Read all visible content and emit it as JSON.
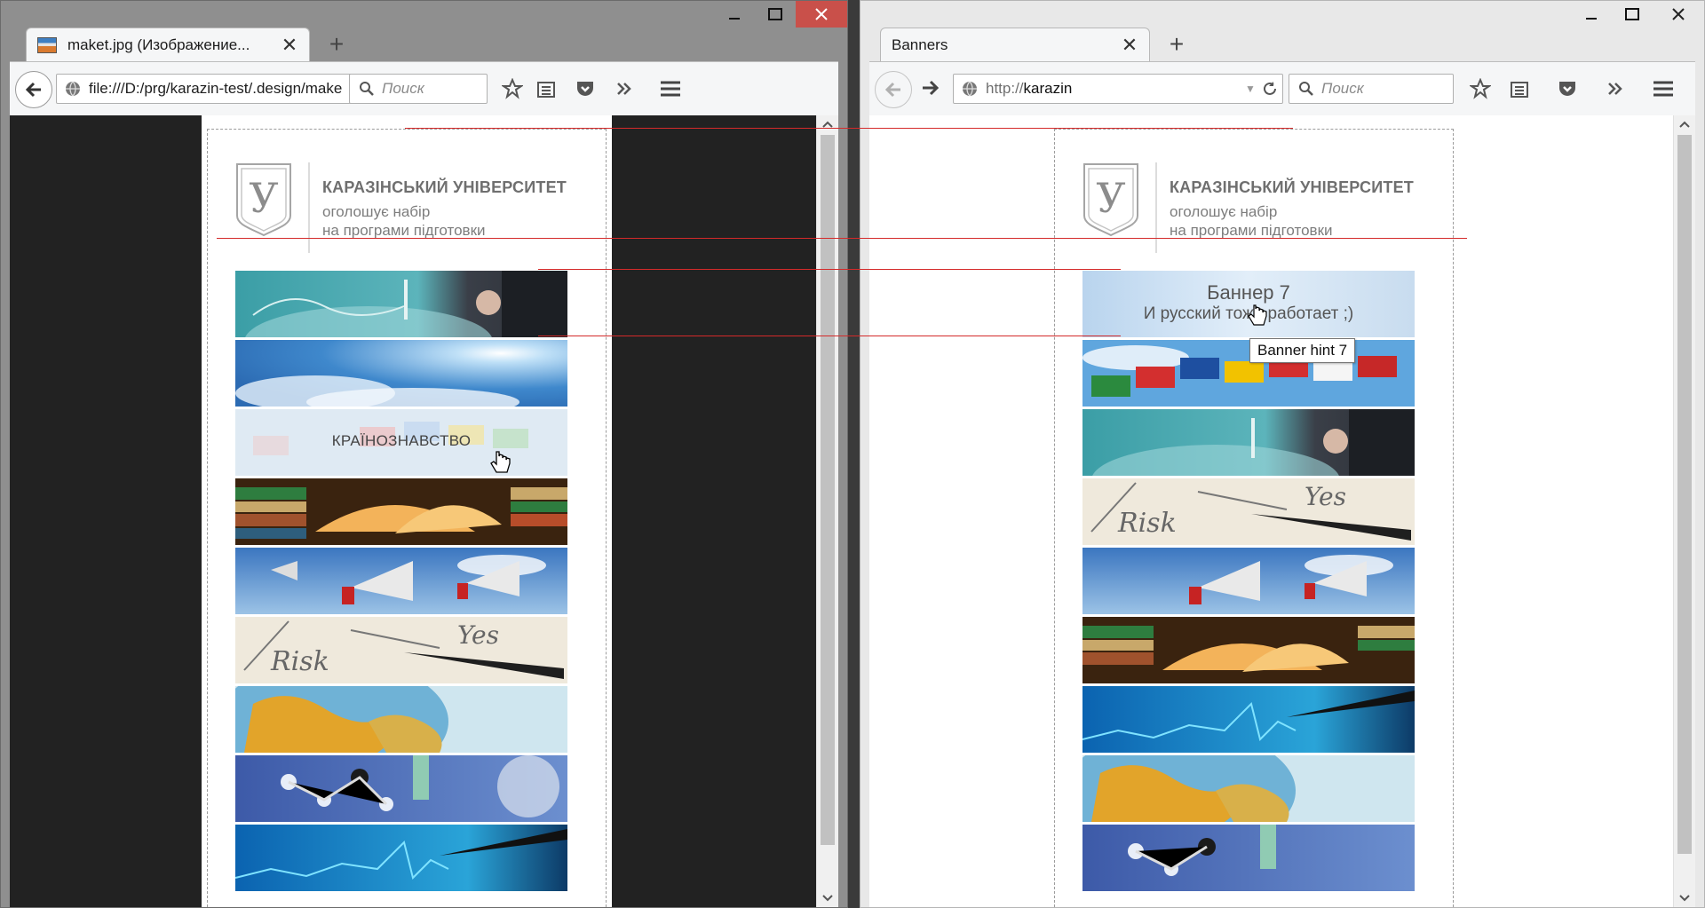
{
  "left_window": {
    "tab_title": "maket.jpg (Изображение...",
    "url": "file:///D:/prg/karazin-test/.design/make",
    "search_placeholder": "Поиск",
    "page": {
      "title": "КАРАЗІНСЬКИЙ УНІВЕРСИТЕТ",
      "subtitle_1": "оголошує набір",
      "subtitle_2": "на програми підготовки",
      "crest_letter": "У",
      "hover_banner_text": "КРАЇНОЗНАВСТВО",
      "banners": [
        "travel-globe",
        "sky-sun",
        "flags-hover",
        "books",
        "megaphone",
        "risk-yes",
        "globe-map",
        "molecules",
        "finance-chart"
      ]
    }
  },
  "right_window": {
    "tab_title": "Banners",
    "url_proto": "http://",
    "url_host": "karazin",
    "search_placeholder": "Поиск",
    "page": {
      "title": "КАРАЗІНСЬКИЙ УНІВЕРСИТЕТ",
      "subtitle_1": "оголошує набір",
      "subtitle_2": "на програми підготовки",
      "crest_letter": "У",
      "banner7_title": "Баннер 7",
      "banner7_subtitle": "И русский тоже работает ;)",
      "tooltip": "Banner hint 7",
      "banners": [
        "banner-7-sky",
        "flags",
        "travel-globe",
        "risk-yes",
        "megaphone",
        "books",
        "finance-chart",
        "globe-map",
        "molecules"
      ]
    }
  },
  "colors": {
    "close_button": "#c9504a",
    "guide_line": "#d42a2a",
    "title_text": "#6f6f6f"
  }
}
